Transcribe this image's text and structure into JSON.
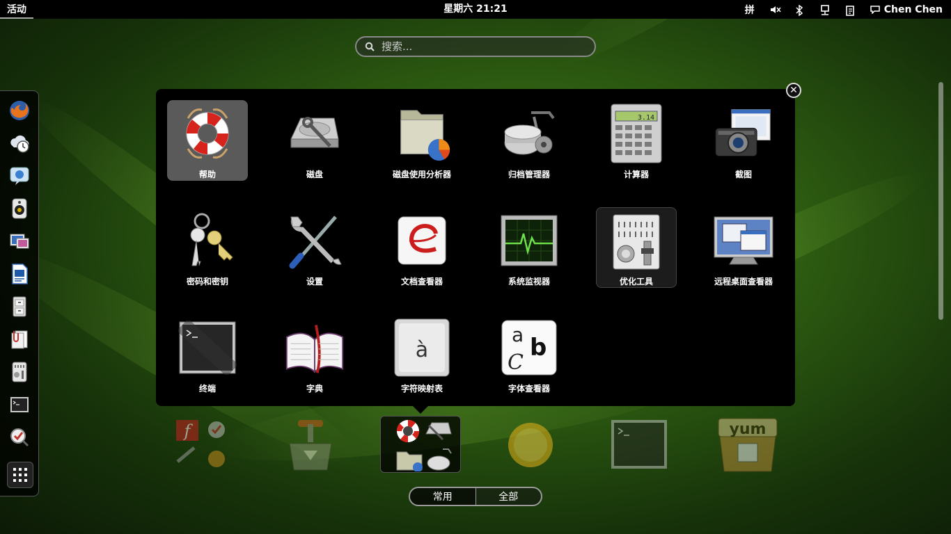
{
  "topbar": {
    "activities": "活动",
    "clock": "星期六 21:21",
    "input_method": "拼",
    "user_name": "Chen Chen"
  },
  "search": {
    "placeholder": "搜索..."
  },
  "apps": [
    {
      "label": "帮助",
      "icon": "help-lifebuoy-icon"
    },
    {
      "label": "磁盘",
      "icon": "disk-utility-icon"
    },
    {
      "label": "磁盘使用分析器",
      "icon": "disk-usage-analyzer-icon"
    },
    {
      "label": "归档管理器",
      "icon": "archive-manager-icon"
    },
    {
      "label": "计算器",
      "icon": "calculator-icon"
    },
    {
      "label": "截图",
      "icon": "screenshot-camera-icon"
    },
    {
      "label": "密码和密钥",
      "icon": "keys-icon"
    },
    {
      "label": "设置",
      "icon": "settings-tools-icon"
    },
    {
      "label": "文档查看器",
      "icon": "document-viewer-icon"
    },
    {
      "label": "系统监视器",
      "icon": "system-monitor-icon"
    },
    {
      "label": "优化工具",
      "icon": "tweak-tool-icon"
    },
    {
      "label": "远程桌面查看器",
      "icon": "remote-desktop-icon"
    },
    {
      "label": "终端",
      "icon": "terminal-icon"
    },
    {
      "label": "字典",
      "icon": "dictionary-icon"
    },
    {
      "label": "字符映射表",
      "icon": "character-map-icon"
    },
    {
      "label": "字体查看器",
      "icon": "font-viewer-icon"
    }
  ],
  "calculator_display": "3.14",
  "char_map_glyph": "à",
  "font_viewer_glyphs": {
    "a": "a",
    "b": "b",
    "c": "C"
  },
  "toggle": {
    "frequent": "常用",
    "all": "全部"
  },
  "colors": {
    "selected_bg": "#5a5a5a",
    "panel_bg": "#000000"
  }
}
